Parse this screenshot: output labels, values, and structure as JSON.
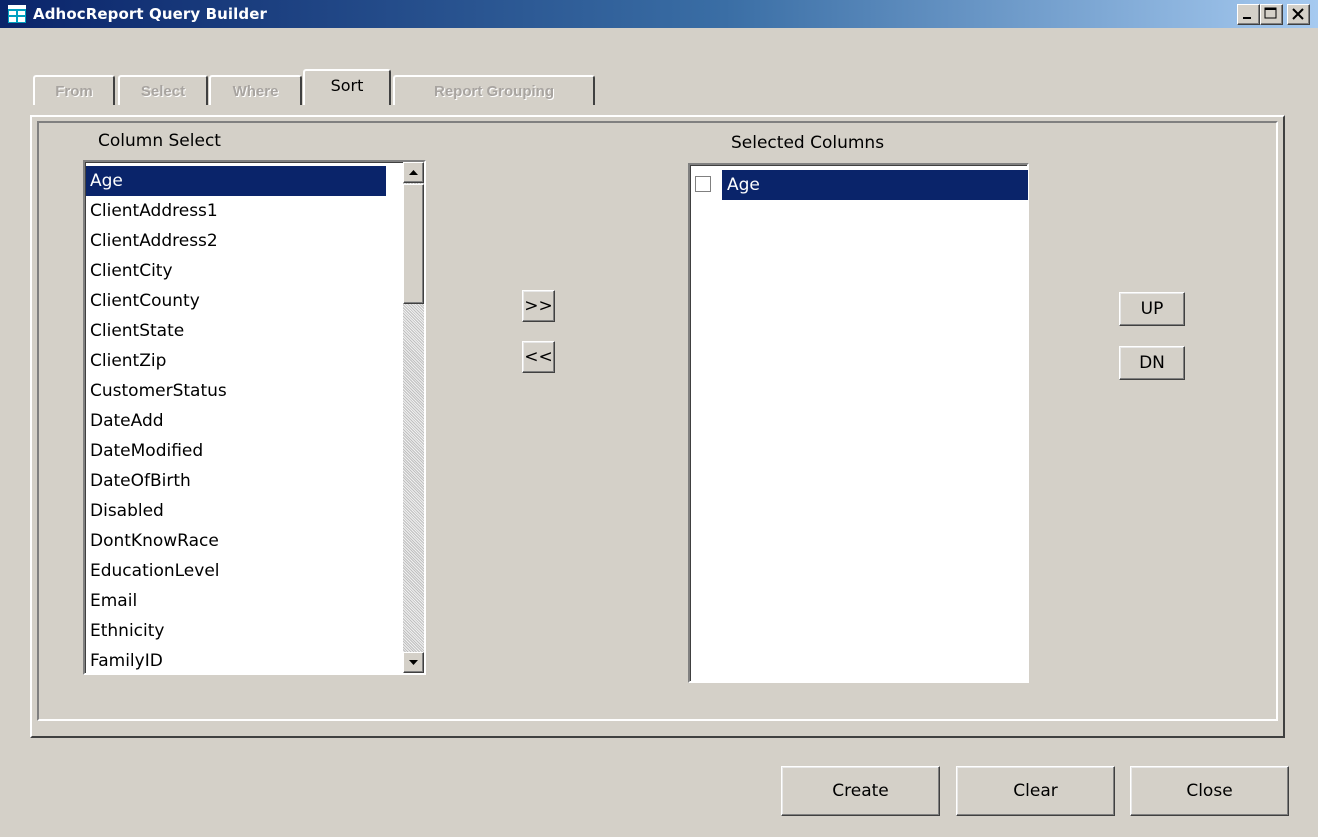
{
  "window": {
    "title": "AdhocReport Query Builder",
    "controls": [
      "minimize",
      "maximize",
      "close"
    ]
  },
  "tabs": [
    {
      "label": "From",
      "active": false
    },
    {
      "label": "Select",
      "active": false
    },
    {
      "label": "Where",
      "active": false
    },
    {
      "label": "Sort",
      "active": true
    },
    {
      "label": "Report Grouping",
      "active": false
    }
  ],
  "column_select": {
    "label": "Column Select",
    "selected": "Age",
    "items": [
      "Age",
      "ClientAddress1",
      "ClientAddress2",
      "ClientCity",
      "ClientCounty",
      "ClientState",
      "ClientZip",
      "CustomerStatus",
      "DateAdd",
      "DateModified",
      "DateOfBirth",
      "Disabled",
      "DontKnowRace",
      "EducationLevel",
      "Email",
      "Ethnicity",
      "FamilyID"
    ]
  },
  "transfer": {
    "add_label": ">>",
    "remove_label": "<<"
  },
  "selected_columns": {
    "label": "Selected Columns",
    "items": [
      {
        "label": "Age",
        "checked": false,
        "selected": true
      }
    ]
  },
  "order": {
    "up_label": "UP",
    "down_label": "DN"
  },
  "footer": {
    "create_label": "Create",
    "clear_label": "Clear",
    "close_label": "Close"
  },
  "colors": {
    "selection": "#0a246a",
    "face": "#d4d0c8",
    "title_start": "#0a246a",
    "title_end": "#a6caf0"
  }
}
